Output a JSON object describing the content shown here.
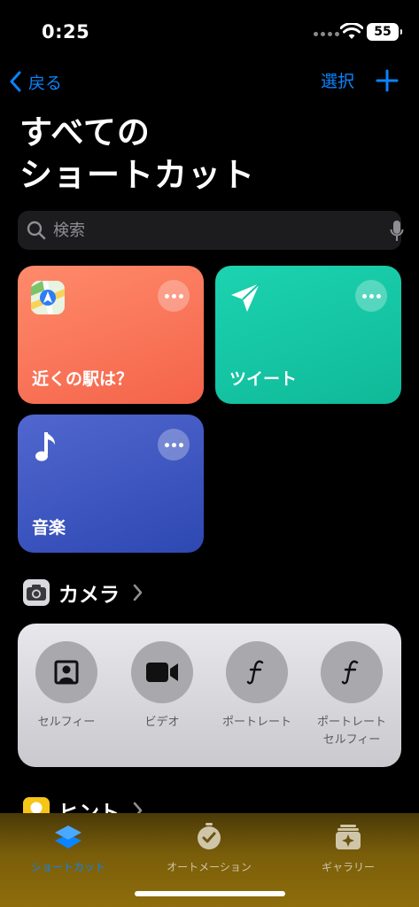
{
  "status": {
    "time": "0:25",
    "battery": "55"
  },
  "nav": {
    "back_label": "戻る",
    "select_label": "選択"
  },
  "title": {
    "line1": "すべての",
    "line2": "ショートカット"
  },
  "search": {
    "placeholder": "検索"
  },
  "tiles": [
    {
      "label": "近くの駅は？",
      "color": "#f4644a"
    },
    {
      "label": "ツイート",
      "color": "#0fb998"
    },
    {
      "label": "音楽",
      "color": "#2e48b2"
    }
  ],
  "sections": {
    "camera": {
      "title": "カメラ"
    },
    "hint": {
      "title": "ヒント"
    }
  },
  "camera_items": [
    {
      "label": "セルフィー",
      "icon": "portrait-frame-icon"
    },
    {
      "label": "ビデオ",
      "icon": "video-camera-icon"
    },
    {
      "label": "ポートレート",
      "icon": "f-stop-icon"
    },
    {
      "label": "ポートレート\nセルフィー",
      "icon": "f-stop-icon"
    }
  ],
  "tabs": [
    {
      "label": "ショートカット",
      "active": true
    },
    {
      "label": "オートメーション",
      "active": false
    },
    {
      "label": "ギャラリー",
      "active": false
    }
  ],
  "colors": {
    "accent": "#0a84ff"
  }
}
